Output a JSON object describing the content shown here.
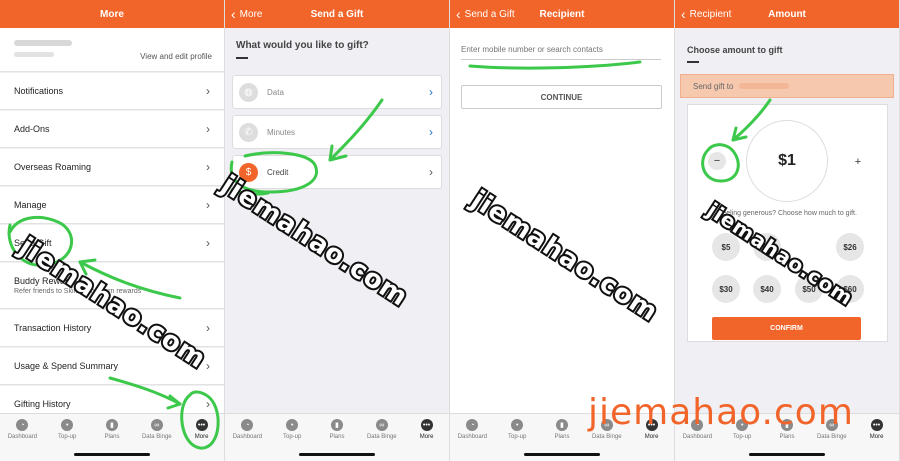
{
  "screen1": {
    "title": "More",
    "profile_link": "View and edit profile",
    "menu": [
      {
        "label": "Notifications"
      },
      {
        "label": "Add-Ons"
      },
      {
        "label": "Overseas Roaming"
      },
      {
        "label": "Manage"
      },
      {
        "label": "Send Gift"
      },
      {
        "label": "Buddy Rewards",
        "sub": "Refer friends to Skinny and earn rewards"
      },
      {
        "label": "Transaction History"
      },
      {
        "label": "Usage & Spend Summary"
      },
      {
        "label": "Gifting History"
      }
    ]
  },
  "screen2": {
    "back": "More",
    "title": "Send a Gift",
    "question": "What would you like to gift?",
    "options": [
      {
        "label": "Data",
        "icon": "globe-icon"
      },
      {
        "label": "Minutes",
        "icon": "phone-icon"
      },
      {
        "label": "Credit",
        "icon": "credit-icon"
      }
    ]
  },
  "screen3": {
    "back": "Send a Gift",
    "title": "Recipient",
    "placeholder": "Enter mobile number or search contacts",
    "continue": "CONTINUE"
  },
  "screen4": {
    "back": "Recipient",
    "title": "Amount",
    "heading": "Choose amount to gift",
    "send_to": "Send gift to",
    "selected_amount": "$1",
    "minus": "−",
    "plus": "+",
    "feeling_text": "Feeling generous? Choose how much to gift.",
    "amounts": [
      "$5",
      "$9",
      "$26",
      "$30",
      "$40",
      "$50",
      "$60"
    ],
    "confirm": "CONFIRM"
  },
  "tabbar": [
    {
      "label": "Dashboard",
      "icon": "dashboard-icon"
    },
    {
      "label": "Top-up",
      "icon": "topup-icon"
    },
    {
      "label": "Plans",
      "icon": "plans-icon"
    },
    {
      "label": "Data Binge",
      "icon": "infinity-icon"
    },
    {
      "label": "More",
      "icon": "more-icon"
    }
  ],
  "watermark": "jiemahao.com",
  "colors": {
    "brand": "#f2652a",
    "link": "#1976d2",
    "annotation": "#3cc84a"
  }
}
